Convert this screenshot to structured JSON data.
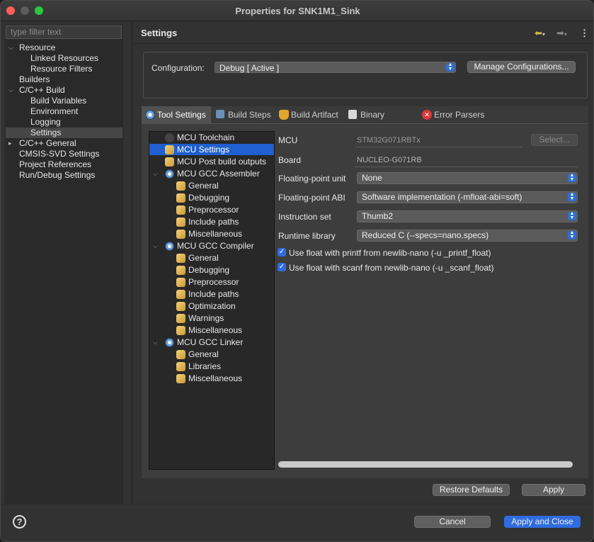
{
  "window": {
    "title": "Properties for SNK1M1_Sink"
  },
  "nav": {
    "filter_placeholder": "type filter text",
    "items": [
      {
        "label": "Resource"
      },
      {
        "label": "Linked Resources"
      },
      {
        "label": "Resource Filters"
      },
      {
        "label": "Builders"
      },
      {
        "label": "C/C++ Build"
      },
      {
        "label": "Build Variables"
      },
      {
        "label": "Environment"
      },
      {
        "label": "Logging"
      },
      {
        "label": "Settings"
      },
      {
        "label": "C/C++ General"
      },
      {
        "label": "CMSIS-SVD Settings"
      },
      {
        "label": "Project References"
      },
      {
        "label": "Run/Debug Settings"
      }
    ]
  },
  "header": {
    "title": "Settings"
  },
  "config": {
    "label": "Configuration:",
    "value": "Debug  [ Active ]",
    "manage_label": "Manage Configurations..."
  },
  "tabs": [
    {
      "label": "Tool Settings"
    },
    {
      "label": "Build Steps"
    },
    {
      "label": "Build Artifact"
    },
    {
      "label": "Binary Parsers"
    },
    {
      "label": "Error Parsers"
    }
  ],
  "tree": [
    {
      "label": "MCU Toolchain"
    },
    {
      "label": "MCU Settings"
    },
    {
      "label": "MCU Post build outputs"
    },
    {
      "label": "MCU GCC Assembler"
    },
    {
      "label": "General"
    },
    {
      "label": "Debugging"
    },
    {
      "label": "Preprocessor"
    },
    {
      "label": "Include paths"
    },
    {
      "label": "Miscellaneous"
    },
    {
      "label": "MCU GCC Compiler"
    },
    {
      "label": "General"
    },
    {
      "label": "Debugging"
    },
    {
      "label": "Preprocessor"
    },
    {
      "label": "Include paths"
    },
    {
      "label": "Optimization"
    },
    {
      "label": "Warnings"
    },
    {
      "label": "Miscellaneous"
    },
    {
      "label": "MCU GCC Linker"
    },
    {
      "label": "General"
    },
    {
      "label": "Libraries"
    },
    {
      "label": "Miscellaneous"
    }
  ],
  "form": {
    "mcu_label": "MCU",
    "mcu_value": "STM32G071RBTx",
    "select_label": "Select...",
    "board_label": "Board",
    "board_value": "NUCLEO-G071RB",
    "fpu_label": "Floating-point unit",
    "fpu_value": "None",
    "fpabi_label": "Floating-point ABI",
    "fpabi_value": "Software implementation (-mfloat-abi=soft)",
    "iset_label": "Instruction set",
    "iset_value": "Thumb2",
    "rtlib_label": "Runtime library",
    "rtlib_value": "Reduced C (--specs=nano.specs)",
    "printf_label": "Use float with printf from newlib-nano (-u _printf_float)",
    "printf_checked": true,
    "scanf_label": "Use float with scanf from newlib-nano (-u _scanf_float)",
    "scanf_checked": true
  },
  "buttons": {
    "restore_defaults": "Restore Defaults",
    "apply": "Apply",
    "cancel": "Cancel",
    "apply_close": "Apply and Close",
    "help": "?"
  },
  "colors": {
    "accent": "#2f6ce0",
    "selection": "#1f5fcf"
  }
}
